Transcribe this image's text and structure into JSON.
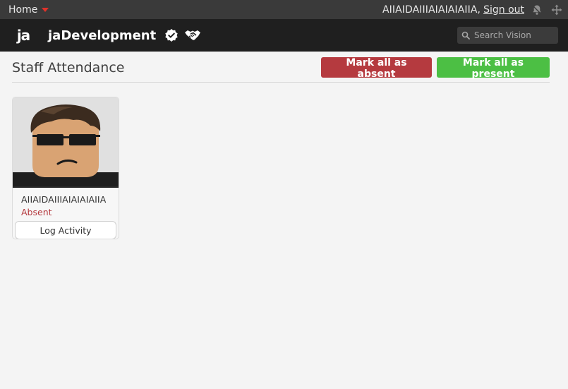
{
  "topbar": {
    "home_label": "Home",
    "username": "AIIAIDAIIIAIAIAIAIIA,",
    "signout_label": "Sign out",
    "icons": [
      "bell-icon",
      "move-icon"
    ]
  },
  "header": {
    "logo_text": "ja",
    "brand_name": "jaDevelopment",
    "badges": [
      "verified-badge-icon",
      "partner-handshake-icon"
    ]
  },
  "search": {
    "placeholder": "Search Vision"
  },
  "page": {
    "title": "Staff Attendance",
    "mark_absent_label": "Mark all as absent",
    "mark_present_label": "Mark all as present"
  },
  "staff": [
    {
      "name": "AIIAIDAIIIAIAIAIAIIA",
      "status": "Absent",
      "log_label": "Log Activity"
    }
  ],
  "colors": {
    "absent": "#b53a3f",
    "present": "#4cbf44",
    "header_bg": "#1f1f1f",
    "topbar_bg": "#3a3a3a"
  }
}
